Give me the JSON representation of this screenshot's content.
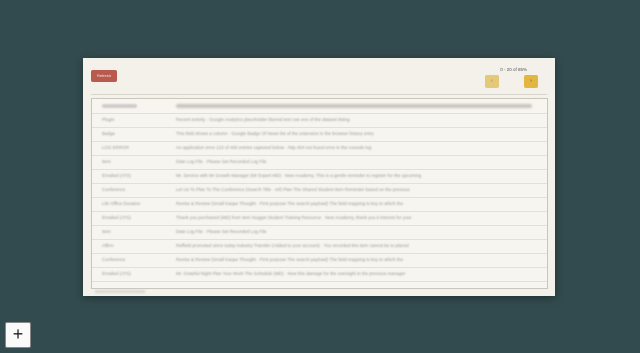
{
  "toolbar": {
    "refresh_label": "Refresh",
    "page_info": "0 - 20 of 85%",
    "prev_label": "‹",
    "next_label": "›"
  },
  "rows": [
    {
      "c1": "Plugin",
      "c2": "Recent activity · Google Analytics placeholder blurred text row one of the dataset listing"
    },
    {
      "c1": "Badge",
      "c2": "This field shows a column · Google Badge Of News list of the extension in the browser history entry"
    },
    {
      "c1": "LOG ERROR",
      "c2": "An application error 123 of 400 entries captured below · http 404 not found error in the console log"
    },
    {
      "c1": "Item",
      "c2": "Date Log File · Please Set Recorded Log File"
    },
    {
      "c1": "Emailed (ATS)",
      "c2": "Mr. Service with Mr Growth Manager (Mr Expert MD) · New Academy, This is a gentle reminder to register for the upcoming"
    },
    {
      "c1": "Conference",
      "c2": "Let Us To Plan To The Conference (Search Title · ref) Plan The Shared Student Item Reminder based on the previous"
    },
    {
      "c1": "Life Office Duration",
      "c2": "Revise & Review (Small Kaspe Thought · First purpose The search payload) The field mapping is key to which the"
    },
    {
      "c1": "Emailed (ATS)",
      "c2": "Thank you purchased (MD) from Item Nugget Student Training Resource · New Academy, thank you it interest for your"
    },
    {
      "c1": "Item",
      "c2": "Date Log File · Please Set Recorded Log File"
    },
    {
      "c1": "Affirm",
      "c2": "Reffield promoted since today Industry Transfer (Added to your account) · You recorded this item cannot be to placed"
    },
    {
      "c1": "Conference",
      "c2": "Revise & Review (Small Kaspe Thought · First purpose The search payload) The field mapping is key to which the"
    },
    {
      "c1": "Emailed (ATS)",
      "c2": "Mr. Grateful Night Plan Your Work The Schedule (MD) · New this damage for the oversight in the previous manager"
    }
  ]
}
